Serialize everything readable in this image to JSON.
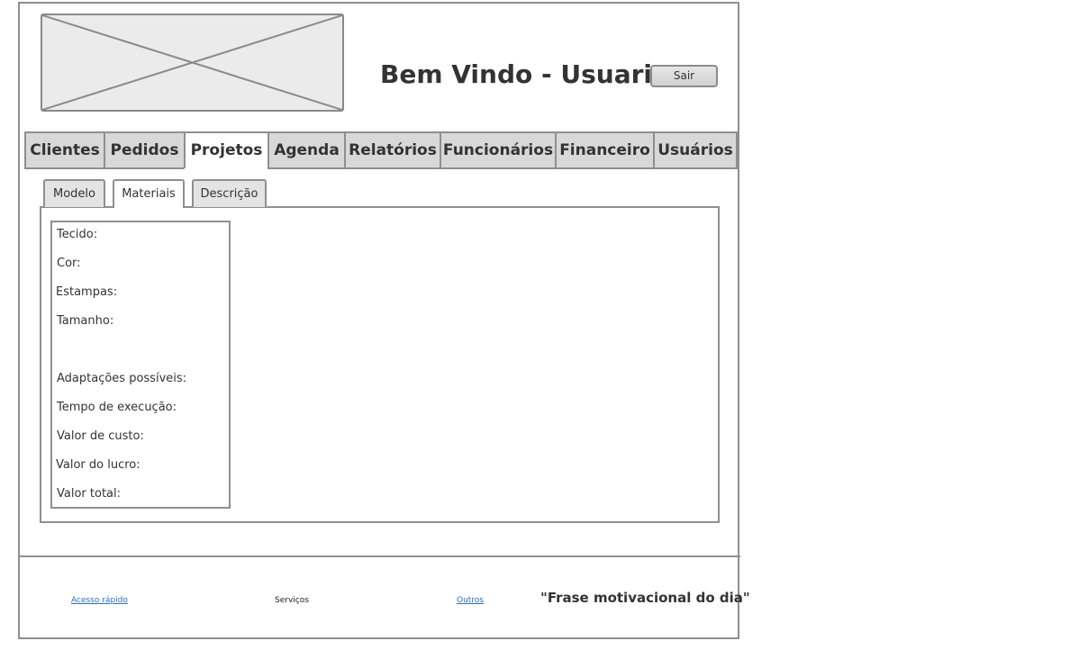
{
  "header": {
    "logo_icon": "image-placeholder-icon",
    "welcome_text": "Bem Vindo - Usuario",
    "logout_label": "Sair"
  },
  "nav": {
    "items": [
      {
        "label": "Clientes"
      },
      {
        "label": "Pedidos"
      },
      {
        "label": "Projetos",
        "active": true
      },
      {
        "label": "Agenda"
      },
      {
        "label": "Relatórios"
      },
      {
        "label": "Funcionários"
      },
      {
        "label": "Financeiro"
      },
      {
        "label": "Usuários"
      }
    ]
  },
  "subtabs": {
    "items": [
      {
        "label": "Modelo"
      },
      {
        "label": "Materiais",
        "active": true
      },
      {
        "label": "Descrição"
      }
    ]
  },
  "materials": {
    "fields": [
      {
        "label": "Tecido:"
      },
      {
        "label": "Cor:"
      },
      {
        "label": "Estampas:"
      },
      {
        "label": "Tamanho:"
      },
      {
        "label": "Adaptações possíveis:"
      },
      {
        "label": "Tempo de execução:"
      },
      {
        "label": "Valor de custo:"
      },
      {
        "label": "Valor do lucro:"
      },
      {
        "label": "Valor total:"
      }
    ]
  },
  "footer": {
    "quick_access": "Acesso rápido",
    "services": "Serviços",
    "others": "Outros",
    "quote": "\"Frase motivacional do dia\""
  },
  "colors": {
    "border": "#8f8f8f",
    "tab_inactive": "#d8d8d8",
    "link": "#2a6ec8"
  }
}
